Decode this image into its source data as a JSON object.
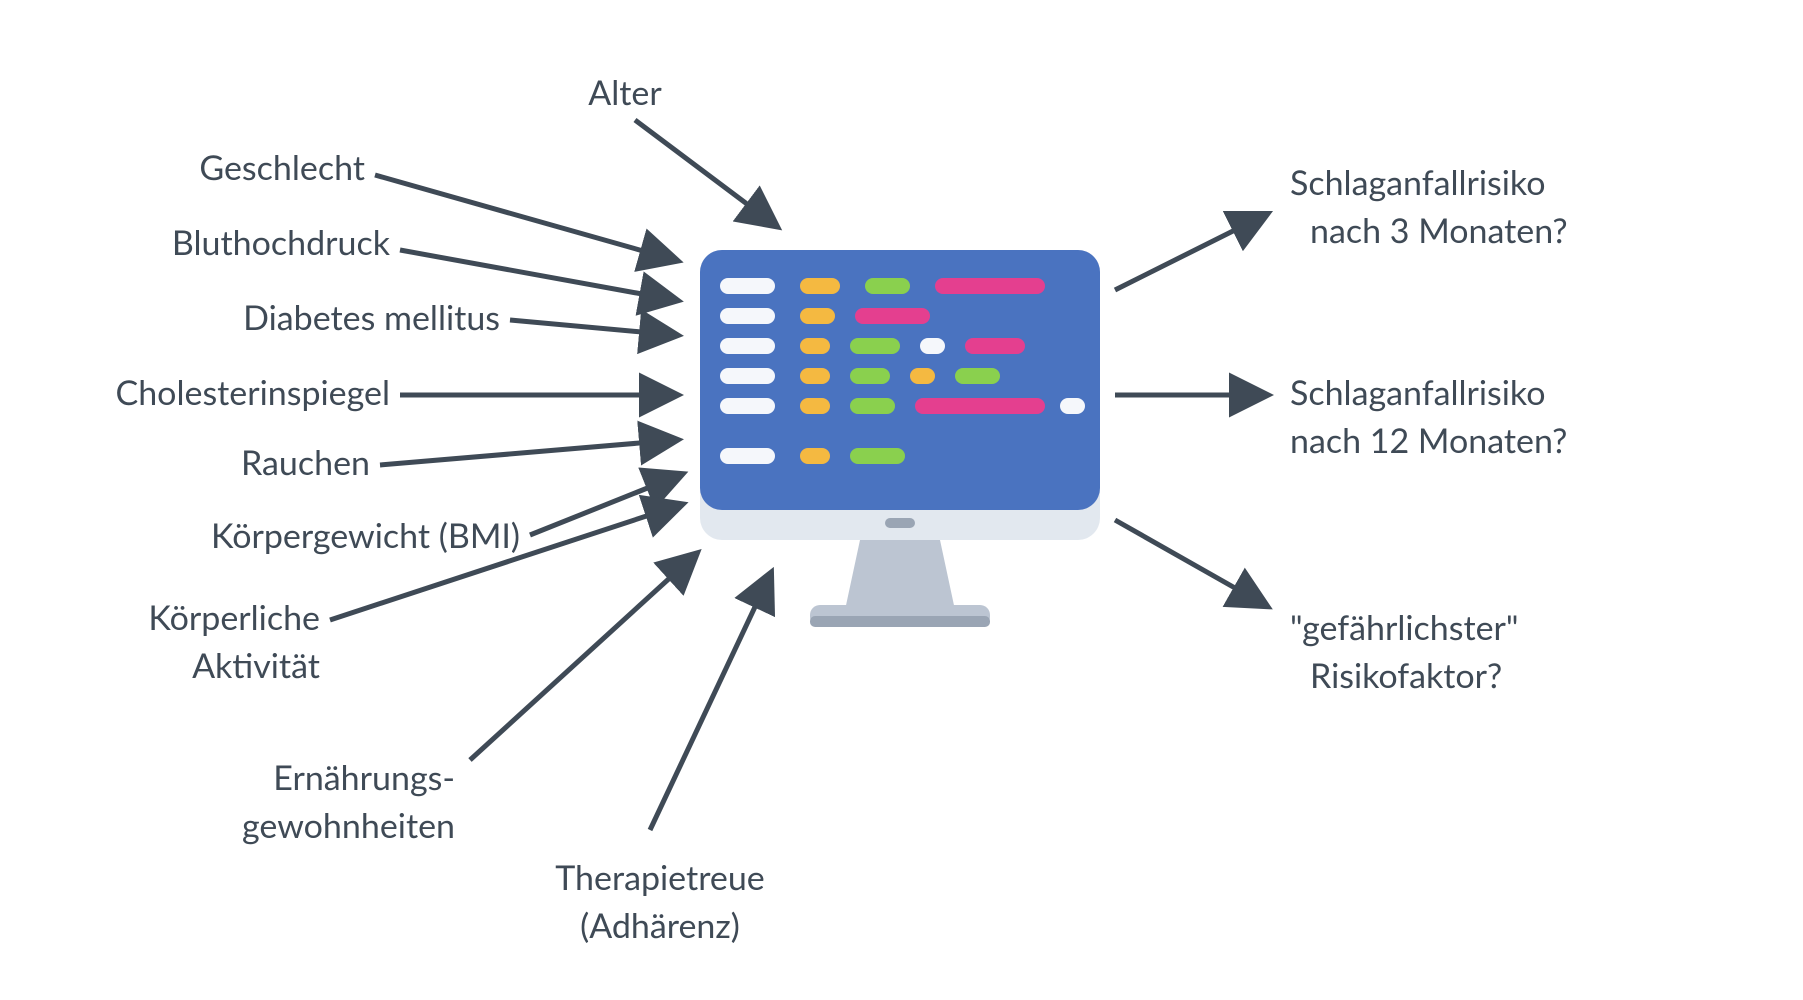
{
  "inputs": {
    "alter": "Alter",
    "geschlecht": "Geschlecht",
    "bluthochdruck": "Bluthochdruck",
    "diabetes": "Diabetes mellitus",
    "cholesterin": "Cholesterinspiegel",
    "rauchen": "Rauchen",
    "bmi": "Körpergewicht (BMI)",
    "aktivitaet_l1": "Körperliche",
    "aktivitaet_l2": "Aktivität",
    "ernaehrung_l1": "Ernährungs-",
    "ernaehrung_l2": "gewohnheiten",
    "adhaerenz_l1": "Therapietreue",
    "adhaerenz_l2": "(Adhärenz)"
  },
  "outputs": {
    "risk3_l1": "Schlaganfallrisiko",
    "risk3_l2": "nach 3 Monaten?",
    "risk12_l1": "Schlaganfallrisiko",
    "risk12_l2": "nach 12 Monaten?",
    "worst_l1": "\"gefährlichster\"",
    "worst_l2": "Risikofaktor?"
  },
  "colors": {
    "arrow": "#3f4a56",
    "text": "#3f4a56",
    "screen": "#4a73c0",
    "case": "#e2e8ef",
    "stand": "#bcc5d2",
    "chip_white": "#f5f7fb",
    "chip_yellow": "#f4b941",
    "chip_green": "#8ad04e",
    "chip_pink": "#e43f8f"
  }
}
